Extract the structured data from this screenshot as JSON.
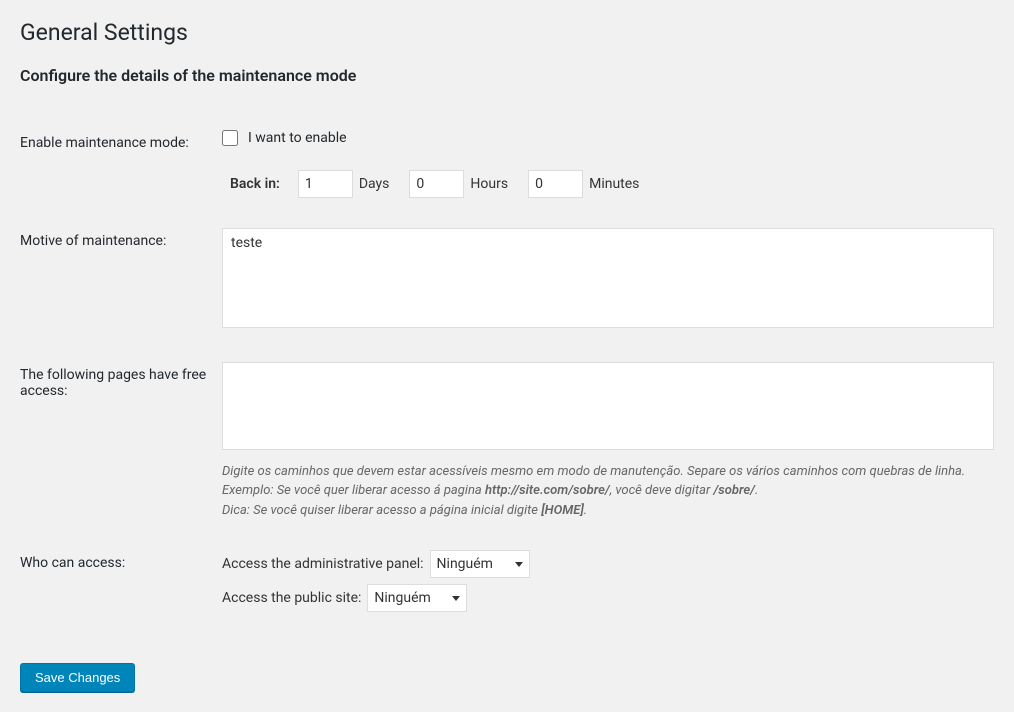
{
  "page": {
    "title": "General Settings",
    "subtitle": "Configure the details of the maintenance mode"
  },
  "enable": {
    "label": "Enable maintenance mode:",
    "checkbox_label": "I want to enable",
    "checked": false,
    "back_in_label": "Back in:",
    "days_value": "1",
    "days_unit": "Days",
    "hours_value": "0",
    "hours_unit": "Hours",
    "minutes_value": "0",
    "minutes_unit": "Minutes"
  },
  "motive": {
    "label": "Motive of maintenance:",
    "value": "teste"
  },
  "free_access": {
    "label": "The following pages have free access:",
    "value": "",
    "hint_line1_a": "Digite os caminhos que devem estar acessíveis mesmo em modo de manutenção. Separe os vários caminhos com quebras de linha.",
    "hint_line2_a": "Exemplo: Se você quer liberar acesso á pagina ",
    "hint_line2_b": "http://site.com/sobre/",
    "hint_line2_c": ", você deve digitar ",
    "hint_line2_d": "/sobre/",
    "hint_line2_e": ".",
    "hint_line3_a": "Dica: Se você quiser liberar acesso a página inicial digite ",
    "hint_line3_b": "[HOME]",
    "hint_line3_c": "."
  },
  "who_access": {
    "label": "Who can access:",
    "admin_label": "Access the administrative panel:",
    "admin_value": "Ninguém",
    "public_label": "Access the public site:",
    "public_value": "Ninguém"
  },
  "submit": {
    "label": "Save Changes"
  }
}
